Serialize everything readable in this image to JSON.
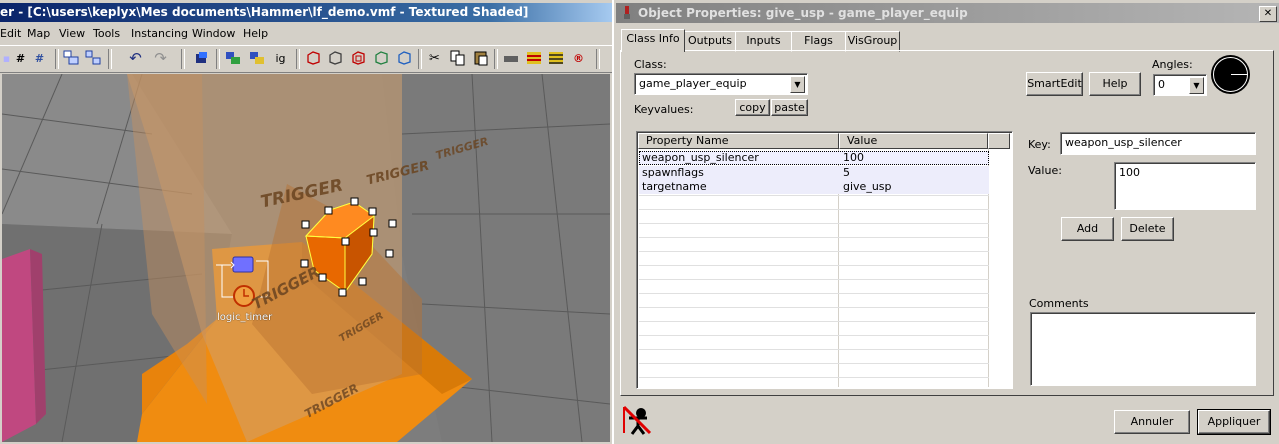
{
  "hammer": {
    "title": "er - [C:\\users\\keplyx\\Mes documents\\Hammer\\lf_demo.vmf - Textured Shaded]",
    "menu": [
      "Edit",
      "Map",
      "View",
      "Tools",
      "Instancing",
      "Window",
      "Help"
    ],
    "toolbar_glyphs": {
      "grid_a": "#",
      "grid_b": "#",
      "ig": "ig",
      "undo": "↶",
      "redo": "↷",
      "cut": "✂",
      "radio": "®"
    },
    "viewport": {
      "trigger_text": "TRIGGER",
      "entity_label": "logic_timer"
    }
  },
  "props": {
    "title": "Object Properties: give_usp - game_player_equip",
    "tabs": [
      "Class Info",
      "Outputs",
      "Inputs",
      "Flags",
      "VisGroup"
    ],
    "class_label": "Class:",
    "class_value": "game_player_equip",
    "keyvalues_label": "Keyvalues:",
    "copy_label": "copy",
    "paste_label": "paste",
    "smartedit_label": "SmartEdit",
    "help_label": "Help",
    "angles_label": "Angles:",
    "angles_value": "0",
    "columns": [
      "Property Name",
      "Value"
    ],
    "rows": [
      {
        "name": "weapon_usp_silencer",
        "value": "100"
      },
      {
        "name": "spawnflags",
        "value": "5"
      },
      {
        "name": "targetname",
        "value": "give_usp"
      }
    ],
    "key_label": "Key:",
    "key_value": "weapon_usp_silencer",
    "value_label": "Value:",
    "value_value": "100",
    "add_label": "Add",
    "delete_label": "Delete",
    "comments_label": "Comments",
    "comments_value": "",
    "cancel_label": "Annuler",
    "apply_label": "Appliquer"
  }
}
